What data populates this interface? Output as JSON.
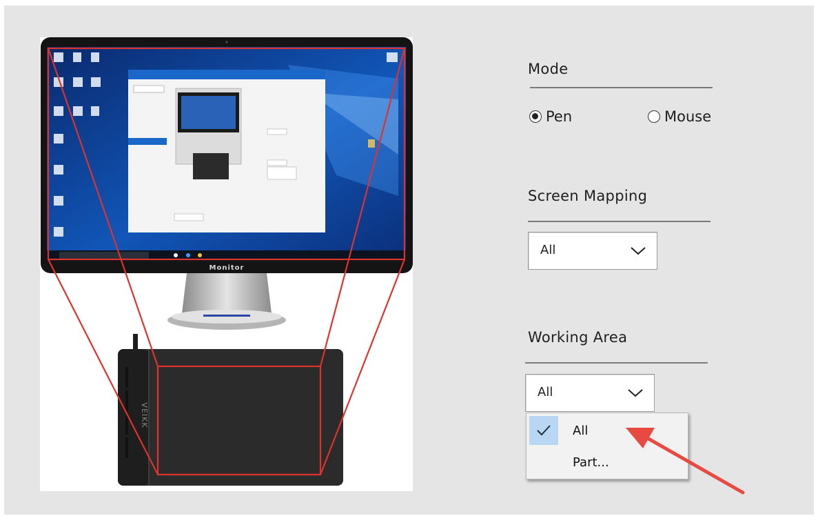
{
  "mode": {
    "heading": "Mode",
    "options": [
      {
        "label": "Pen",
        "selected": true
      },
      {
        "label": "Mouse",
        "selected": false
      }
    ]
  },
  "screen_mapping": {
    "heading": "Screen Mapping",
    "selected": "All"
  },
  "working_area": {
    "heading": "Working Area",
    "selected": "All",
    "options": [
      {
        "label": "All",
        "checked": true
      },
      {
        "label": "Part...",
        "checked": false
      }
    ]
  },
  "illustration": {
    "monitor_label": "Monitor",
    "tablet_brand": "VEIKK",
    "highlight_color": "#e0322c"
  },
  "colors": {
    "panel_bg": "#e5e5e5",
    "check_highlight": "#b9d6f2",
    "arrow": "#e84a40"
  }
}
